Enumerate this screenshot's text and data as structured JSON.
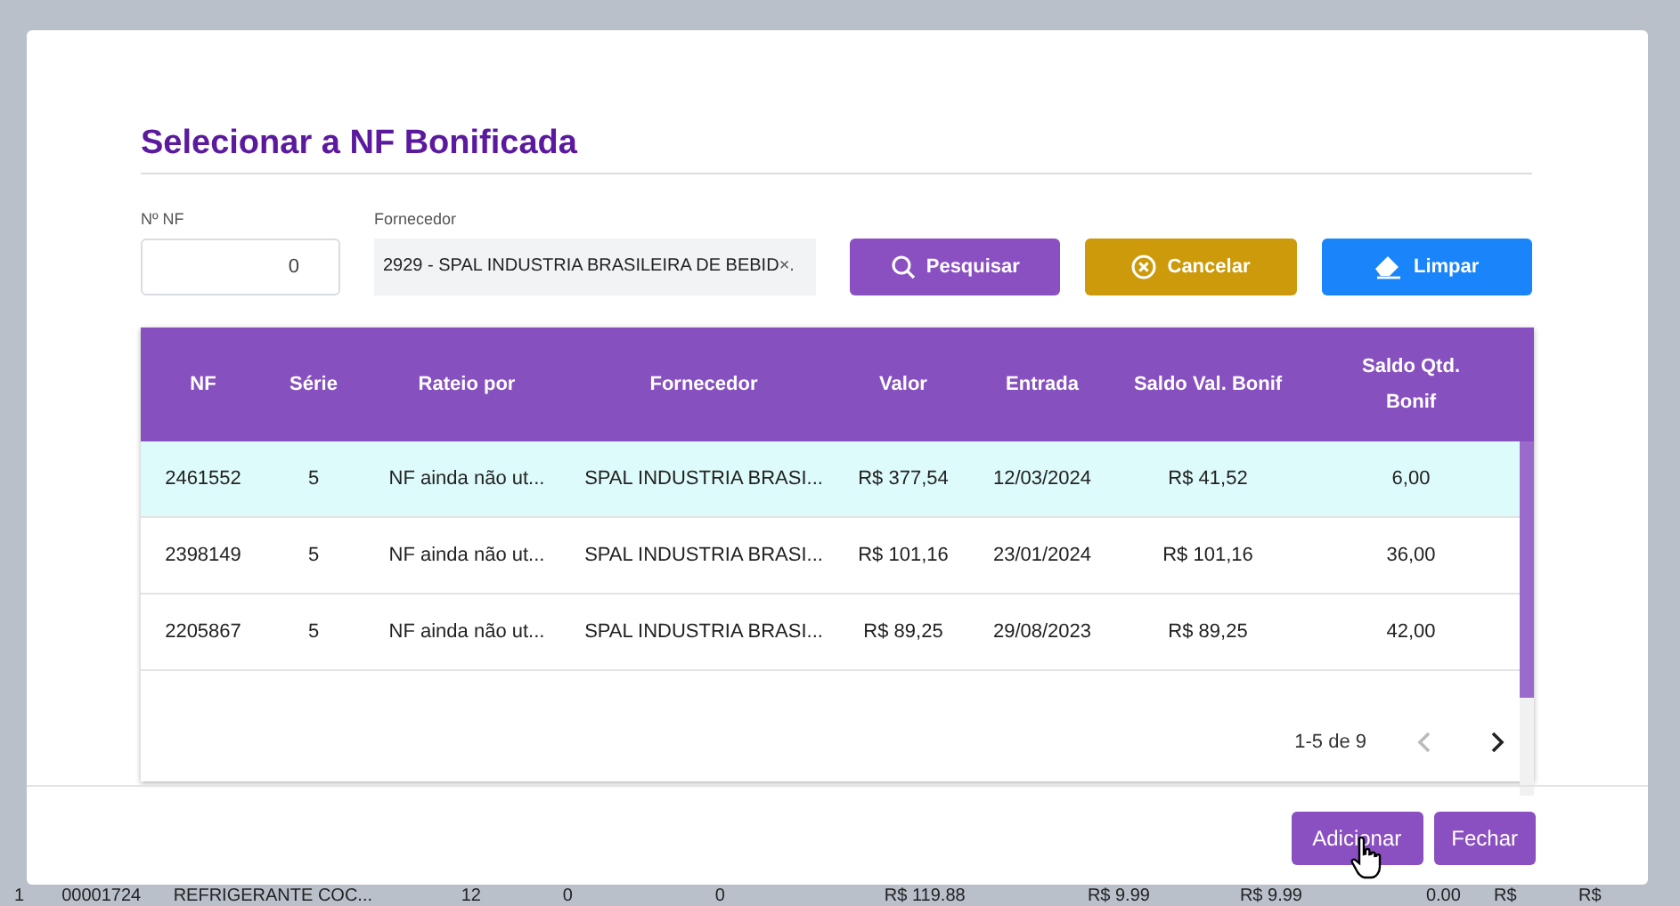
{
  "dialog": {
    "title": "Selecionar a NF Bonificada",
    "nf_field": {
      "label": "Nº NF",
      "value": "0"
    },
    "supplier_field": {
      "label": "Fornecedor",
      "value": "2929 - SPAL INDUSTRIA BRASILEIRA DE BEBID",
      "clear": "×."
    },
    "buttons": [
      {
        "label": "Pesquisar",
        "kind": "search"
      },
      {
        "label": "Cancelar",
        "kind": "cancel"
      },
      {
        "label": "Limpar",
        "kind": "clear"
      }
    ],
    "table": {
      "columns": [
        "NF",
        "Série",
        "Rateio por",
        "Fornecedor",
        "Valor",
        "Entrada",
        "Saldo Val. Bonif",
        "Saldo Qtd. Bonif"
      ],
      "rows": [
        {
          "selected": true,
          "cells": [
            "2461552",
            "5",
            "NF ainda não ut...",
            "SPAL INDUSTRIA BRASI...",
            "R$ 377,54",
            "12/03/2024",
            "R$ 41,52",
            "6,00"
          ]
        },
        {
          "selected": false,
          "cells": [
            "2398149",
            "5",
            "NF ainda não ut...",
            "SPAL INDUSTRIA BRASI...",
            "R$ 101,16",
            "23/01/2024",
            "R$ 101,16",
            "36,00"
          ]
        },
        {
          "selected": false,
          "cells": [
            "2205867",
            "5",
            "NF ainda não ut...",
            "SPAL INDUSTRIA BRASI...",
            "R$ 89,25",
            "29/08/2023",
            "R$ 89,25",
            "42,00"
          ]
        }
      ],
      "pagination": {
        "range": "1-5 de 9",
        "prev_disabled": true,
        "next_disabled": false
      }
    },
    "footer_buttons": [
      "Adicionar",
      "Fechar"
    ]
  },
  "background_row": [
    "1",
    "00001724",
    "REFRIGERANTE COC...",
    "12",
    "0",
    "0",
    "R$ 119.88",
    "R$ 9.99",
    "R$ 9.99",
    "0.00",
    "R$",
    "R$"
  ]
}
